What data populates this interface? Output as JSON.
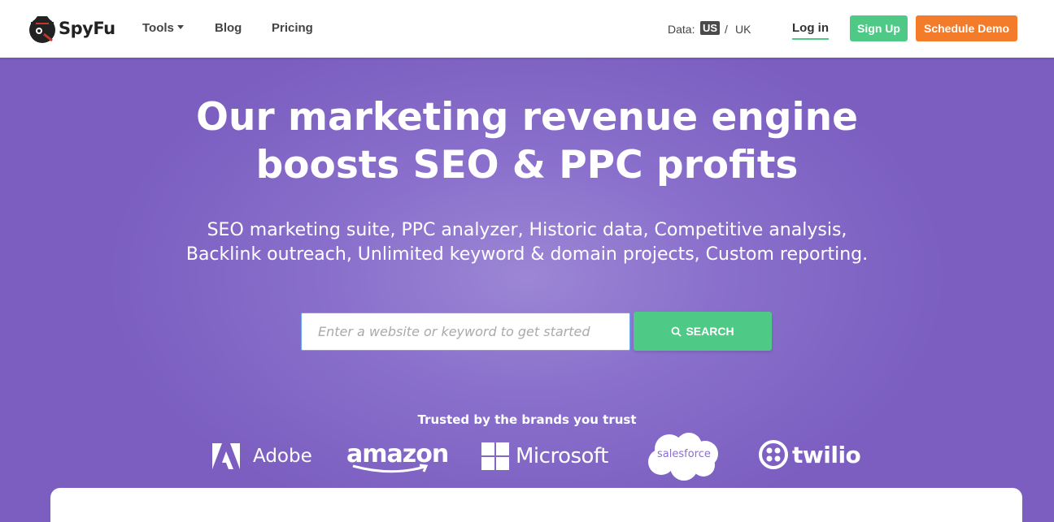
{
  "header": {
    "logo_text": "SpyFu",
    "nav": {
      "tools": "Tools",
      "blog": "Blog",
      "pricing": "Pricing"
    },
    "data_label": "Data:",
    "data_us": "US",
    "data_sep": "/",
    "data_uk": "UK",
    "login": "Log in",
    "signup": "Sign Up",
    "demo": "Schedule Demo"
  },
  "hero": {
    "headline_line1": "Our marketing revenue engine",
    "headline_line2": "boosts SEO & PPC profits",
    "subhead_line1": "SEO marketing suite, PPC analyzer, Historic data, Competitive analysis,",
    "subhead_line2": "Backlink outreach, Unlimited keyword & domain projects, Custom reporting.",
    "search": {
      "placeholder": "Enter a website or keyword to get started",
      "button_label": "SEARCH",
      "icon": "search-icon"
    },
    "trusted_label": "Trusted by the brands you trust",
    "brands": {
      "adobe": "Adobe",
      "amazon": "amazon",
      "microsoft": "Microsoft",
      "salesforce": "salesforce",
      "twilio": "twilio"
    }
  },
  "colors": {
    "hero_bg": "#7b5ec0",
    "green": "#4fc986",
    "orange": "#f47b2a"
  }
}
